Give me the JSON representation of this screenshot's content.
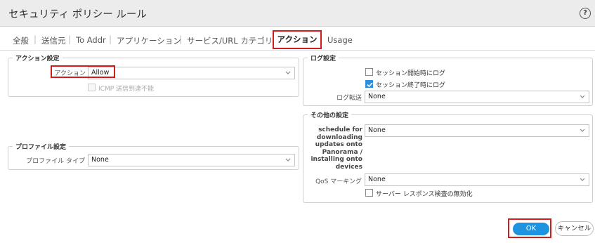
{
  "dialog": {
    "title": "セキュリティ ポリシー ルール",
    "help_icon": "?"
  },
  "tabs": [
    {
      "label": "全般"
    },
    {
      "label": "送信元"
    },
    {
      "label": "To Addr"
    },
    {
      "label": "アプリケーション"
    },
    {
      "label": "サービス/URL カテゴリ"
    },
    {
      "label": "アクション",
      "active": true
    },
    {
      "label": "Usage"
    }
  ],
  "action_settings": {
    "legend": "アクション設定",
    "action_label": "アクション",
    "action_value": "Allow",
    "icmp_label": "ICMP 送信到達不能",
    "icmp_checked": false
  },
  "profile_settings": {
    "legend": "プロファイル設定",
    "profile_type_label": "プロファイル タイプ",
    "profile_type_value": "None"
  },
  "log_settings": {
    "legend": "ログ設定",
    "log_at_session_start_label": "セッション開始時にログ",
    "log_at_session_start_checked": false,
    "log_at_session_end_label": "セッション終了時にログ",
    "log_at_session_end_checked": true,
    "log_forwarding_label": "ログ転送",
    "log_forwarding_value": "None"
  },
  "other_settings": {
    "legend": "その他の設定",
    "schedule_label_lines": [
      "schedule for",
      "downloading",
      "updates onto",
      "Panorama /",
      "installing onto",
      "devices"
    ],
    "schedule_value": "None",
    "qos_label": "QoS マーキング",
    "qos_value": "None",
    "disable_server_response_label": "サーバー レスポンス検査の無効化",
    "disable_server_response_checked": false
  },
  "footer": {
    "ok_label": "OK",
    "cancel_label": "キャンセル"
  },
  "colors": {
    "accent": "#1e93e0",
    "highlight_box": "#d01c1c",
    "check": "#2f8fd8"
  }
}
